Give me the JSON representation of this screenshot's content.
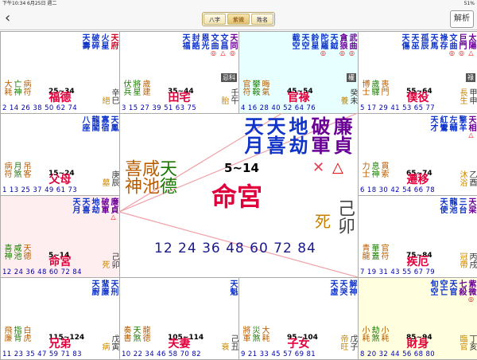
{
  "status": {
    "time": "下午10:34",
    "date": "6月25日 週二",
    "battery": "51%"
  },
  "nav": {
    "back": "‹",
    "tabs": [
      "八字",
      "紫微",
      "姓名"
    ],
    "active": 1,
    "analyze": "解析"
  },
  "colors": {
    "purple": "#6a0096",
    "blue": "#1034c8",
    "red": "#d00020",
    "green": "#1a7a00",
    "orange": "#b85c00",
    "pink": "#e0003c"
  },
  "cells": [
    {
      "id": "c0",
      "pal": "福德",
      "age": "25~34",
      "stem": "辛",
      "br": "巳",
      "chs": "絕",
      "minor": [
        "大",
        "耗"
      ],
      "minor2": [
        "亡",
        "神"
      ],
      "minor3": [
        "病",
        "符"
      ],
      "mc": "#b85c00",
      "stars": [
        {
          "n": "天府",
          "c": "#d00020",
          "m": ""
        },
        {
          "n": "火星",
          "c": "#1034c8",
          "m": ""
        },
        {
          "n": "破碎",
          "c": "#1034c8",
          "m": ""
        },
        {
          "n": "天壽",
          "c": "#1034c8",
          "m": ""
        }
      ],
      "yrs": "2 14 26 38 50 62 74",
      "bg": "#fff"
    },
    {
      "id": "c1",
      "pal": "田宅",
      "age": "35~44",
      "stem": "壬",
      "br": "午",
      "chs": "胎",
      "minor": [
        "伏",
        "兵"
      ],
      "minor2": [
        "將",
        "星"
      ],
      "minor3": [
        "歲",
        "建"
      ],
      "mc": "#1a7a00",
      "stars": [
        {
          "n": "天同",
          "c": "#6a0096",
          "m": "◎"
        },
        {
          "n": "文昌",
          "c": "#1034c8",
          "m": "△"
        },
        {
          "n": "文曲",
          "c": "#1034c8",
          "m": "◎"
        },
        {
          "n": "恩光",
          "c": "#1034c8",
          "m": ""
        },
        {
          "n": "封誥",
          "c": "#1034c8",
          "m": ""
        },
        {
          "n": "天福",
          "c": "#1034c8",
          "m": ""
        }
      ],
      "yrs": "3 15 27 39 51 63 75",
      "bg": "#fff",
      "hua": "忌科"
    },
    {
      "id": "c2",
      "pal": "官祿",
      "age": "45~54",
      "stem": "癸",
      "br": "未",
      "chs": "養",
      "minor": [
        "官",
        "符"
      ],
      "minor2": [
        "攀",
        "鞍"
      ],
      "minor3": [
        "晦",
        "氣"
      ],
      "mc": "#b85c00",
      "stars": [
        {
          "n": "武曲",
          "c": "#6a0096",
          "m": "◎"
        },
        {
          "n": "貪狼",
          "c": "#6a0096",
          "m": "◎"
        },
        {
          "n": "天鉞",
          "c": "#1034c8",
          "m": ""
        },
        {
          "n": "陀羅",
          "c": "#1034c8",
          "m": "◎"
        },
        {
          "n": "鈴星",
          "c": "#1034c8",
          "m": ""
        },
        {
          "n": "天空",
          "c": "#1034c8",
          "m": ""
        },
        {
          "n": "截空",
          "c": "#1034c8",
          "m": ""
        }
      ],
      "yrs": "4 16 28 40 52 64 76",
      "bg": "#e8ffff",
      "hua": "權"
    },
    {
      "id": "c3",
      "pal": "僕役",
      "age": "55~64",
      "stem": "甲",
      "br": "申",
      "chs": "長生",
      "minor": [
        "博",
        "士"
      ],
      "minor2": [
        "歲",
        "驛"
      ],
      "minor3": [
        "喪",
        "門"
      ],
      "mc": "#b85c00",
      "stars": [
        {
          "n": "太陽",
          "c": "#6a0096",
          "m": "△"
        },
        {
          "n": "巨門",
          "c": "#6a0096",
          "m": "◎"
        },
        {
          "n": "文曲",
          "c": "#1034c8",
          "m": "◎"
        },
        {
          "n": "祿存",
          "c": "#1034c8",
          "m": ""
        },
        {
          "n": "天馬",
          "c": "#1034c8",
          "m": ""
        },
        {
          "n": "孤辰",
          "c": "#1034c8",
          "m": ""
        },
        {
          "n": "天巫",
          "c": "#1034c8",
          "m": ""
        },
        {
          "n": "天傷",
          "c": "#1034c8",
          "m": ""
        }
      ],
      "yrs": "5 17 29 41 53 65 77",
      "bg": "#fff",
      "hua": "祿"
    },
    {
      "id": "c4",
      "pal": "父母",
      "age": "15~24",
      "stem": "庚",
      "br": "辰",
      "chs": "墓",
      "minor": [
        "病",
        "符"
      ],
      "minor2": [
        "月",
        "煞"
      ],
      "minor3": [
        "吊",
        "客"
      ],
      "mc": "#b85c00",
      "stars": [
        {
          "n": "天鳳",
          "c": "#1034c8",
          "m": ""
        },
        {
          "n": "寡宿",
          "c": "#1034c8",
          "m": ""
        },
        {
          "n": "龍閣",
          "c": "#1034c8",
          "m": ""
        },
        {
          "n": "八座",
          "c": "#1034c8",
          "m": ""
        }
      ],
      "yrs": "1 13 25 37 49 61 73",
      "bg": "#fff"
    },
    {
      "id": "c5",
      "pal": "遷移",
      "age": "65~74",
      "stem": "乙",
      "br": "酉",
      "chs": "沐浴",
      "minor": [
        "力",
        "士"
      ],
      "minor2": [
        "息",
        "神"
      ],
      "minor3": [
        "貫",
        "索"
      ],
      "mc": "#b85c00",
      "stars": [
        {
          "n": "天相",
          "c": "#6a0096",
          "m": "△"
        },
        {
          "n": "擎羊",
          "c": "#1034c8",
          "m": ""
        },
        {
          "n": "左輔",
          "c": "#1034c8",
          "m": ""
        },
        {
          "n": "紅鸞",
          "c": "#1034c8",
          "m": ""
        },
        {
          "n": "天才",
          "c": "#1034c8",
          "m": ""
        }
      ],
      "yrs": "6 18 30 42 54 66 78",
      "bg": "#fff"
    },
    {
      "id": "c6",
      "pal": "命宮",
      "age": "5~14",
      "stem": "己",
      "br": "卯",
      "chs": "死",
      "minor": [
        "喜",
        "神"
      ],
      "minor2": [
        "咸",
        "池"
      ],
      "minor3": [
        "天",
        "德"
      ],
      "mc": "#1a7a00",
      "stars": [
        {
          "n": "廉貞",
          "c": "#6a0096",
          "m": "△"
        },
        {
          "n": "破軍",
          "c": "#6a0096",
          "m": ""
        },
        {
          "n": "地劫",
          "c": "#1034c8",
          "m": ""
        },
        {
          "n": "天喜",
          "c": "#1034c8",
          "m": ""
        },
        {
          "n": "天月",
          "c": "#1034c8",
          "m": ""
        }
      ],
      "yrs": "12 24 36 48 60 72 84",
      "bg": "#ffeef0"
    },
    {
      "id": "c7",
      "pal": "疾厄",
      "age": "75~84",
      "stem": "丙",
      "br": "戌",
      "chs": "冠帶",
      "minor": [
        "青",
        "龍"
      ],
      "minor2": [
        "華",
        "蓋"
      ],
      "minor3": [
        "官",
        "符"
      ],
      "mc": "#b85c00",
      "stars": [
        {
          "n": "天梁",
          "c": "#6a0096",
          "m": ""
        },
        {
          "n": "三台",
          "c": "#1034c8",
          "m": ""
        },
        {
          "n": "龍池",
          "c": "#1034c8",
          "m": ""
        },
        {
          "n": "天使",
          "c": "#1034c8",
          "m": ""
        }
      ],
      "yrs": "7 19 31 43 55 67 79",
      "bg": "#fff"
    },
    {
      "id": "c8",
      "pal": "兄弟",
      "age": "115~124",
      "stem": "戊",
      "br": "寅",
      "chs": "病",
      "minor": [
        "飛",
        "廉"
      ],
      "minor2": [
        "指",
        "背"
      ],
      "minor3": [
        "白",
        "虎"
      ],
      "mc": "#b85c00",
      "stars": [
        {
          "n": "天刑",
          "c": "#1034c8",
          "m": ""
        },
        {
          "n": "蜚廉",
          "c": "#1034c8",
          "m": ""
        },
        {
          "n": "天廚",
          "c": "#1034c8",
          "m": ""
        }
      ],
      "yrs": "11 23 35 47 59 71 83",
      "bg": "#fff"
    },
    {
      "id": "c9",
      "pal": "夫妻",
      "age": "105~114",
      "stem": "己",
      "br": "丑",
      "chs": "衰",
      "minor": [
        "奏",
        "書"
      ],
      "minor2": [
        "天",
        "煞"
      ],
      "minor3": [
        "龍",
        "德"
      ],
      "mc": "#b85c00",
      "stars": [
        {
          "n": "天魁",
          "c": "#1034c8",
          "m": ""
        }
      ],
      "yrs": "10 22 34 46 58 70 82",
      "bg": "#fff"
    },
    {
      "id": "c10",
      "pal": "子女",
      "age": "95~104",
      "stem": "戊",
      "br": "子",
      "chs": "帝旺",
      "minor": [
        "將",
        "軍"
      ],
      "minor2": [
        "災",
        "煞"
      ],
      "minor3": [
        "大",
        "耗"
      ],
      "mc": "#b85c00",
      "stars": [
        {
          "n": "解神",
          "c": "#1034c8",
          "m": ""
        },
        {
          "n": "天哭",
          "c": "#1034c8",
          "m": ""
        },
        {
          "n": "天虛",
          "c": "#1034c8",
          "m": ""
        }
      ],
      "yrs": "9 21 33 45 57 69 81",
      "bg": "#fff"
    },
    {
      "id": "c11",
      "pal": "財身",
      "age": "85~94",
      "stem": "丁",
      "br": "亥",
      "chs": "臨官",
      "minor": [
        "小",
        "耗"
      ],
      "minor2": [
        "劫",
        "煞"
      ],
      "minor3": [
        "小",
        "耗"
      ],
      "mc": "#b85c00",
      "stars": [
        {
          "n": "紫微",
          "c": "#6a0096",
          "m": "◎"
        },
        {
          "n": "七殺",
          "c": "#6a0096",
          "m": ""
        },
        {
          "n": "天官",
          "c": "#1034c8",
          "m": ""
        },
        {
          "n": "空亡",
          "c": "#1034c8",
          "m": ""
        },
        {
          "n": "旬空",
          "c": "#1034c8",
          "m": ""
        }
      ],
      "yrs": "8 20 32 44 56 68 80",
      "bg": "#ffffe0"
    }
  ],
  "center": {
    "stars": [
      "廉貞",
      "破軍",
      "地劫",
      "天喜",
      "天月"
    ],
    "age": "5~14",
    "pal": "命宮",
    "minor": [
      "喜神",
      "咸池",
      "天德"
    ],
    "stem": "己卯",
    "chs": "死",
    "yrs": "12 24 36 48 60 72 84"
  }
}
